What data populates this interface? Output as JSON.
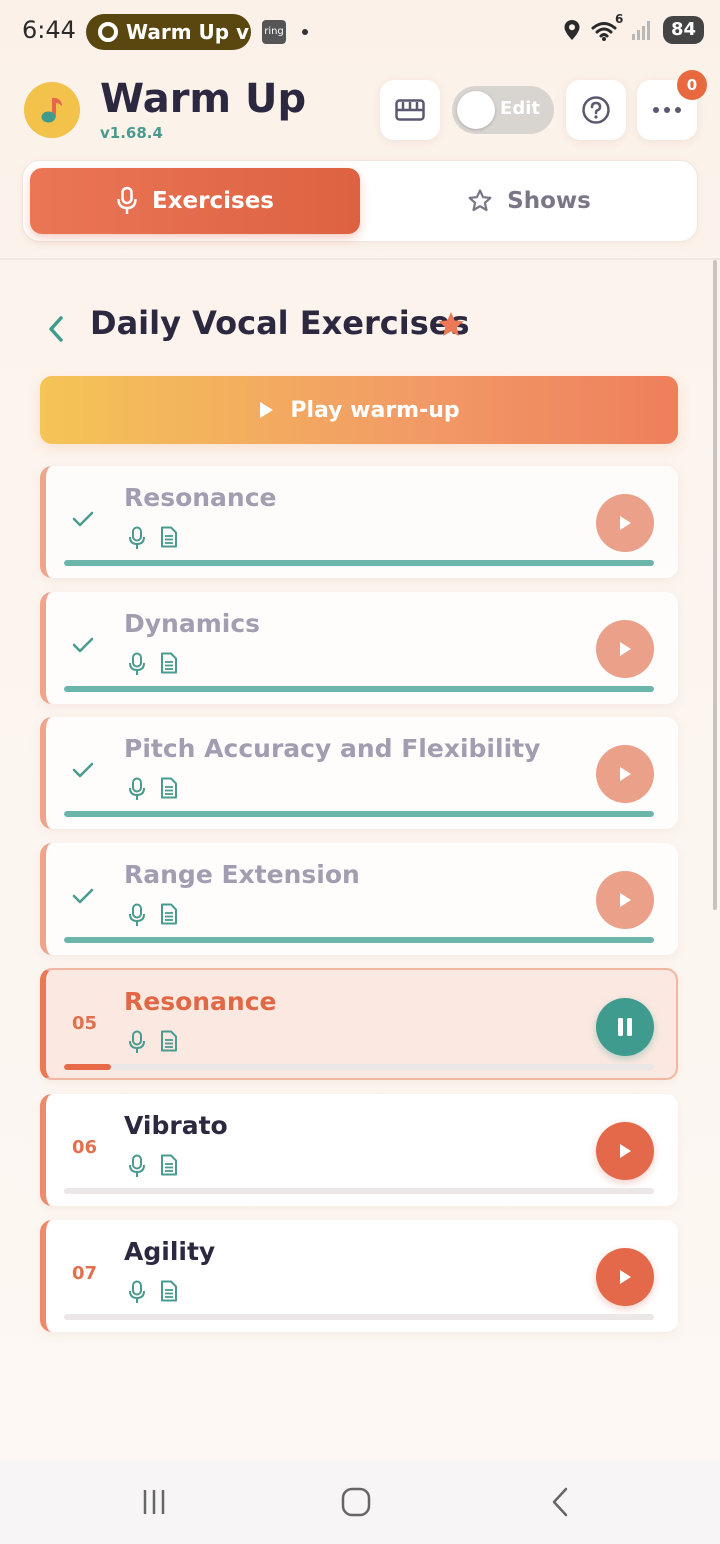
{
  "status_bar": {
    "time": "6:44",
    "pill_text": "Warm Up v",
    "ring_label": "ring",
    "wifi_label": "6",
    "battery": "84"
  },
  "header": {
    "title": "Warm Up",
    "version": "v1.68.4",
    "edit_toggle_label": "Edit",
    "notification_count": "0"
  },
  "tabs": [
    {
      "label": "Exercises",
      "active": true,
      "icon": "mic-icon"
    },
    {
      "label": "Shows",
      "active": false,
      "icon": "star-icon"
    }
  ],
  "section": {
    "title": "Daily Vocal Exercises",
    "favorite": true
  },
  "play_all_label": "Play warm-up",
  "exercises": [
    {
      "title": "Resonance",
      "status": "done",
      "progress": 1.0
    },
    {
      "title": "Dynamics",
      "status": "done",
      "progress": 1.0
    },
    {
      "title": "Pitch Accuracy and Flexibility",
      "status": "done",
      "progress": 1.0
    },
    {
      "title": "Range Extension",
      "status": "done",
      "progress": 1.0
    },
    {
      "number": "05",
      "title": "Resonance",
      "status": "playing",
      "progress": 0.08
    },
    {
      "number": "06",
      "title": "Vibrato",
      "status": "pending",
      "progress": 0.0
    },
    {
      "number": "07",
      "title": "Agility",
      "status": "pending",
      "progress": 0.0
    }
  ],
  "colors": {
    "accent": "#e4684a",
    "teal": "#3f9b8d",
    "text": "#2c2840"
  }
}
